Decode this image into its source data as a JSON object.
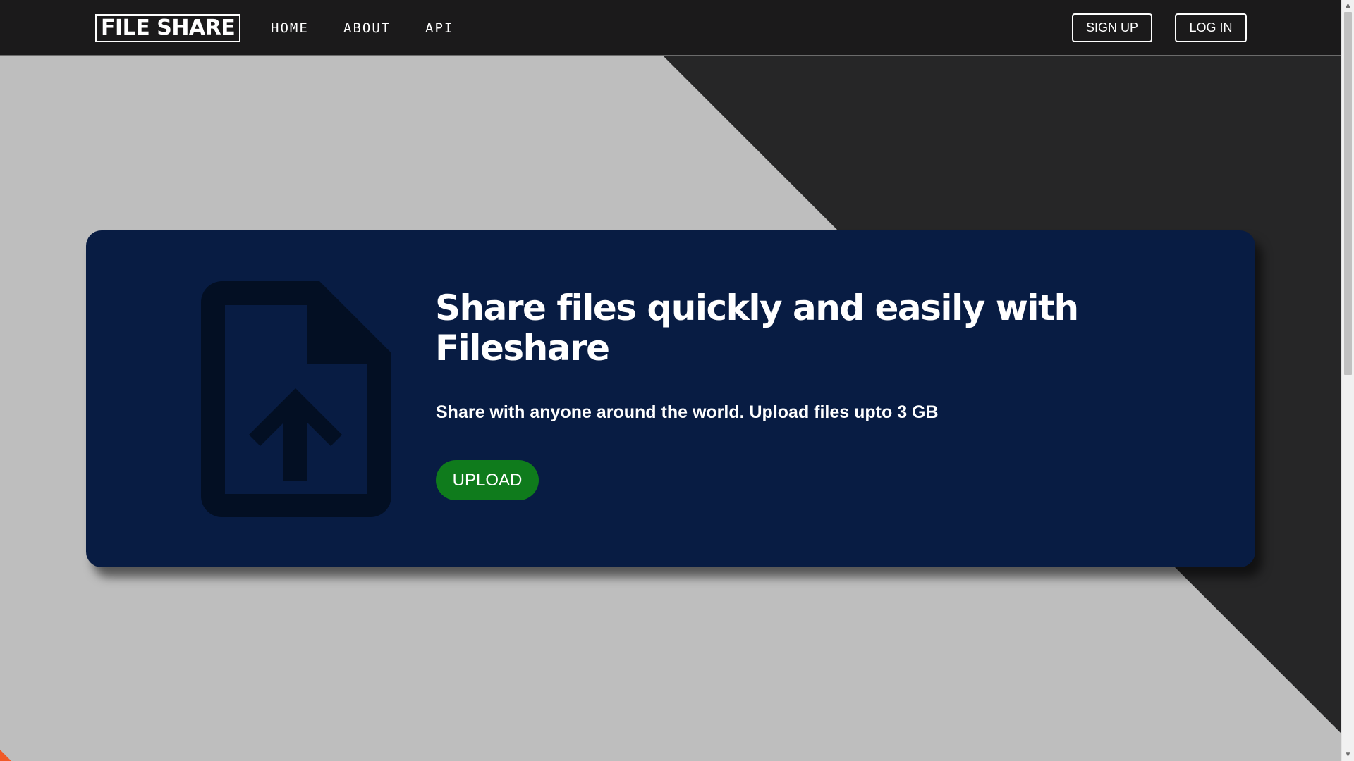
{
  "navbar": {
    "logo": "FILE SHARE",
    "links": [
      {
        "label": "HOME"
      },
      {
        "label": "ABOUT"
      },
      {
        "label": "API"
      }
    ],
    "signup_label": "SIGN UP",
    "login_label": "LOG IN"
  },
  "hero": {
    "icon": "upload-file-icon",
    "title": "Share files quickly and easily with Fileshare",
    "subtitle": "Share with anyone around the world. Upload files upto 3 GB",
    "upload_label": "UPLOAD"
  },
  "colors": {
    "navbar_bg": "#1b1a1b",
    "page_bg": "#bebebe",
    "dark_panel": "#262627",
    "card_bg": "#081c43",
    "icon_color": "#030f23",
    "upload_button": "#0f7b1c",
    "corner_accent": "#f05a28"
  },
  "scrollbar": {
    "up_icon": "triangle-up",
    "down_icon": "triangle-down"
  }
}
